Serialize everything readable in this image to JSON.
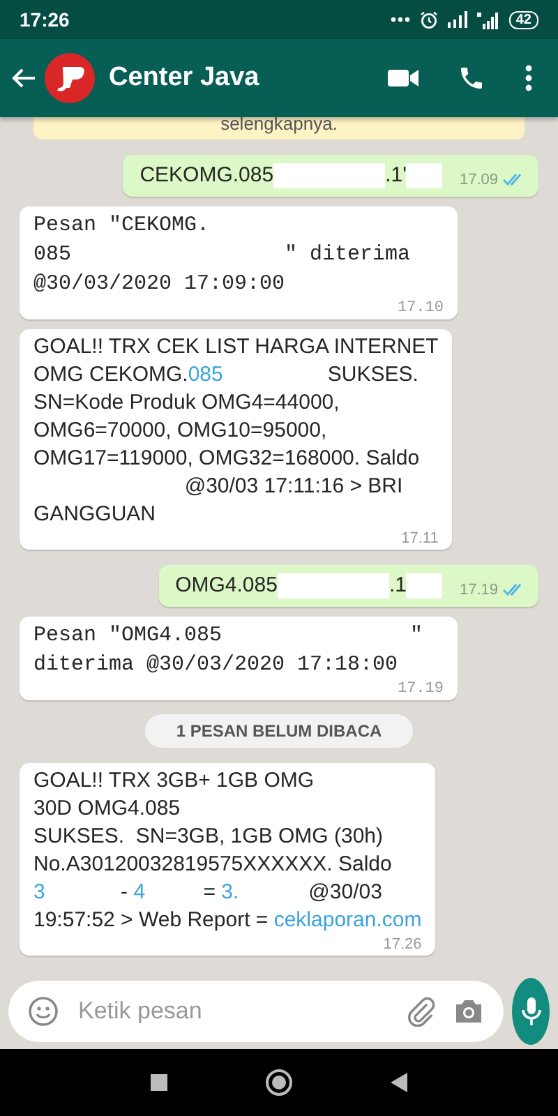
{
  "status_bar": {
    "time": "17:26",
    "battery": "42"
  },
  "header": {
    "title": "Center Java"
  },
  "banner": {
    "text": "selengkapnya."
  },
  "messages": [
    {
      "kind": "out",
      "time": "17.09",
      "read": true,
      "lines": [
        [
          {
            "kind": "text",
            "text": "CEKOMG.085"
          },
          {
            "kind": "redacted_long"
          },
          {
            "kind": "text",
            "text": ".1'"
          },
          {
            "kind": "redacted_short"
          }
        ]
      ]
    },
    {
      "kind": "in_mono",
      "time": "17.10",
      "lines": [
        [
          {
            "kind": "text",
            "text": "Pesan \"CEKOMG."
          }
        ],
        [
          {
            "kind": "text",
            "text": "085                 \" diterima"
          }
        ],
        [
          {
            "kind": "text",
            "text": "@30/03/2020 17:09:00"
          }
        ]
      ]
    },
    {
      "kind": "in",
      "time": "17.11",
      "lines": [
        [
          {
            "kind": "text",
            "text": "GOAL!! TRX CEK LIST HARGA INTERNET"
          }
        ],
        [
          {
            "kind": "text",
            "text": "OMG CEKOMG."
          },
          {
            "kind": "link",
            "text": "085"
          },
          {
            "kind": "text",
            "text": "                  SUKSES."
          }
        ],
        [
          {
            "kind": "text",
            "text": "SN=Kode Produk OMG4=44000,"
          }
        ],
        [
          {
            "kind": "text",
            "text": "OMG6=70000, OMG10=95000,"
          }
        ],
        [
          {
            "kind": "text",
            "text": "OMG17=119000, OMG32=168000. Saldo"
          }
        ],
        [
          {
            "kind": "text",
            "text": "                          @30/03 17:11:16 > BRI"
          }
        ],
        [
          {
            "kind": "text",
            "text": "GANGGUAN"
          }
        ]
      ]
    },
    {
      "kind": "out",
      "time": "17.19",
      "read": true,
      "lines": [
        [
          {
            "kind": "text",
            "text": "OMG4.085"
          },
          {
            "kind": "redacted_long"
          },
          {
            "kind": "text",
            "text": ".1"
          },
          {
            "kind": "redacted_short"
          }
        ]
      ]
    },
    {
      "kind": "in_mono",
      "time": "17.19",
      "lines": [
        [
          {
            "kind": "text",
            "text": "Pesan \"OMG4.085               \""
          }
        ],
        [
          {
            "kind": "text",
            "text": "diterima @30/03/2020 17:18:00"
          }
        ]
      ]
    },
    {
      "kind": "divider",
      "text": "1 PESAN BELUM DIBACA"
    },
    {
      "kind": "in",
      "time": "17.26",
      "lines": [
        [
          {
            "kind": "text",
            "text": "GOAL!! TRX 3GB+ 1GB OMG"
          }
        ],
        [
          {
            "kind": "text",
            "text": "30D OMG4.085"
          }
        ],
        [
          {
            "kind": "text",
            "text": "SUKSES.  SN=3GB, 1GB OMG (30h)"
          }
        ],
        [
          {
            "kind": "text",
            "text": "No.A30120032819575XXXXXX. Saldo"
          }
        ],
        [
          {
            "kind": "link",
            "text": "3"
          },
          {
            "kind": "text",
            "text": "             - "
          },
          {
            "kind": "link",
            "text": "4"
          },
          {
            "kind": "text",
            "text": "          = "
          },
          {
            "kind": "link",
            "text": "3."
          },
          {
            "kind": "text",
            "text": "            @30/03"
          }
        ],
        [
          {
            "kind": "text",
            "text": "19:57:52 > Web Report = "
          },
          {
            "kind": "link",
            "text": "ceklaporan.com"
          }
        ]
      ]
    }
  ],
  "input": {
    "placeholder": "Ketik pesan"
  }
}
